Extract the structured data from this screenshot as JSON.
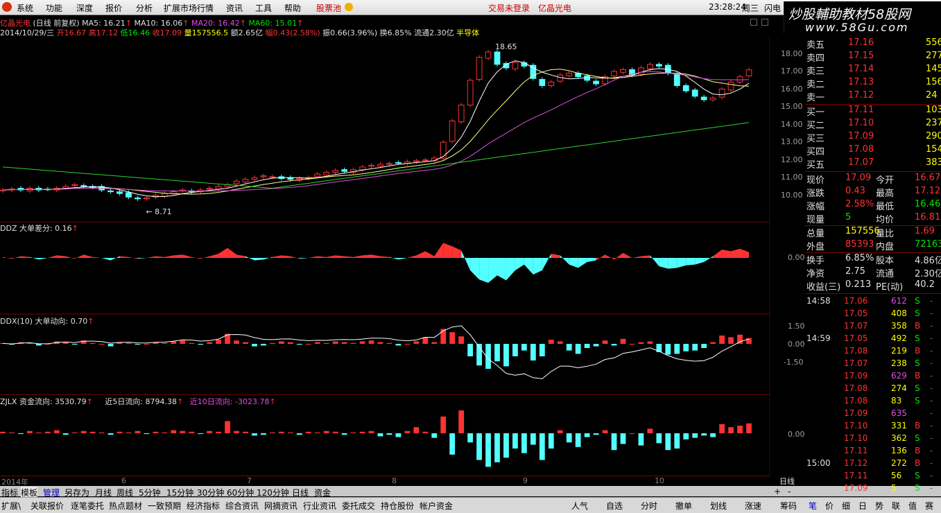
{
  "menu": {
    "items": [
      "系统",
      "功能",
      "深度",
      "报价",
      "分析",
      "扩展市场行情",
      "资讯",
      "工具",
      "帮助"
    ],
    "stock_pool": "股票池",
    "trade_status": "交易未登录",
    "stock_name": "亿晶光电",
    "clock": "23:28:24",
    "weekday": "周三",
    "flash": "闪电",
    "watermark": "炒股輔助教材58股网",
    "watermark_url": "www.58Gu.com"
  },
  "main_chart": {
    "header1_name": "亿晶光电",
    "header1_mode": "(日线 前复权)",
    "ma5": "MA5: 16.21",
    "ma10": "MA10: 16.06",
    "ma20": "MA20: 16.42",
    "ma60": "MA60: 15.01",
    "date": "2014/10/29/三",
    "open": "开16.67",
    "high": "高17.12",
    "low": "低16.46",
    "close": "收17.09",
    "volume": "量157556.5",
    "amount": "额2.65亿",
    "pct": "幅0.43(2.58%)",
    "amp": "振0.66(3.96%)",
    "turnover": "换6.85%",
    "float": "流通2.30亿",
    "sector": "半导体",
    "high_mark": "18.65",
    "low_mark": "8.71",
    "y_ticks": [
      "18.00",
      "17.00",
      "16.00",
      "15.00",
      "14.00",
      "13.00",
      "12.00",
      "11.00",
      "10.00"
    ]
  },
  "ddz": {
    "label": "DDZ 大单差分: 0.16",
    "tick": "0.00"
  },
  "ddx": {
    "label": "DDX(10) 大单动向: 0.70",
    "ticks": [
      "1.50",
      "0.00",
      "-1.50"
    ]
  },
  "zjlx": {
    "label": "ZJLX 资金流向: 3530.79",
    "d5": "近5日流向: 8794.38",
    "d10": "近10日流向: -3023.78",
    "tick": "0.00"
  },
  "time_axis": [
    "2014年",
    "6",
    "7",
    "8",
    "9",
    "10"
  ],
  "daily_label": "日线",
  "tabs_row1": [
    "指标",
    "模板",
    "管理",
    "另存为",
    "月线",
    "周线",
    "5分钟",
    "15分钟",
    "30分钟",
    "60分钟",
    "120分钟",
    "日线",
    "资金"
  ],
  "tabs_row2": [
    "扩展\\",
    "关联报价",
    "逐笔委托",
    "热点题材",
    "一致预期",
    "经济指标",
    "综合资讯",
    "网摘资讯",
    "行业资讯",
    "委托成交",
    "持仓股份",
    "帐户资金"
  ],
  "tabs_row2_right": [
    "人气",
    "自选",
    "分时",
    "撤单",
    "划线",
    "涨速"
  ],
  "tabs_row2_far": [
    "筹码",
    "笔",
    "价",
    "细",
    "日",
    "势",
    "联",
    "值",
    "赛"
  ],
  "quote": {
    "sells": [
      {
        "label": "卖五",
        "price": "17.16",
        "vol": "556"
      },
      {
        "label": "卖四",
        "price": "17.15",
        "vol": "277"
      },
      {
        "label": "卖三",
        "price": "17.14",
        "vol": "145"
      },
      {
        "label": "卖二",
        "price": "17.13",
        "vol": "156"
      },
      {
        "label": "卖一",
        "price": "17.12",
        "vol": "24"
      }
    ],
    "buys": [
      {
        "label": "买一",
        "price": "17.11",
        "vol": "103"
      },
      {
        "label": "买二",
        "price": "17.10",
        "vol": "237"
      },
      {
        "label": "买三",
        "price": "17.09",
        "vol": "290"
      },
      {
        "label": "买四",
        "price": "17.08",
        "vol": "154"
      },
      {
        "label": "买五",
        "price": "17.07",
        "vol": "383"
      }
    ],
    "stats": [
      {
        "k1": "现价",
        "v1": "17.09",
        "c1": "red",
        "k2": "今开",
        "v2": "16.67",
        "c2": "red"
      },
      {
        "k1": "涨跌",
        "v1": "0.43",
        "c1": "red",
        "k2": "最高",
        "v2": "17.12",
        "c2": "red"
      },
      {
        "k1": "涨幅",
        "v1": "2.58%",
        "c1": "red",
        "k2": "最低",
        "v2": "16.46",
        "c2": "grn"
      },
      {
        "k1": "现量",
        "v1": "5",
        "c1": "grn",
        "k2": "均价",
        "v2": "16.81",
        "c2": "red"
      },
      {
        "k1": "总量",
        "v1": "157556",
        "c1": "yel",
        "k2": "量比",
        "v2": "1.69",
        "c2": "red"
      },
      {
        "k1": "外盘",
        "v1": "85393",
        "c1": "red",
        "k2": "内盘",
        "v2": "72163",
        "c2": "grn"
      },
      {
        "k1": "换手",
        "v1": "6.85%",
        "c1": "wht",
        "k2": "股本",
        "v2": "4.86亿",
        "c2": "wht"
      },
      {
        "k1": "净资",
        "v1": "2.75",
        "c1": "wht",
        "k2": "流通",
        "v2": "2.30亿",
        "c2": "wht"
      },
      {
        "k1": "收益(三)",
        "v1": "0.213",
        "c1": "wht",
        "k2": "PE(动)",
        "v2": "40.2",
        "c2": "wht"
      }
    ],
    "ticks": [
      {
        "t": "14:58",
        "p": "17.06",
        "pc": "red",
        "v": "612",
        "vc": "mag",
        "s": "S"
      },
      {
        "t": "",
        "p": "17.05",
        "pc": "red",
        "v": "408",
        "vc": "yel",
        "s": "S"
      },
      {
        "t": "",
        "p": "17.07",
        "pc": "red",
        "v": "358",
        "vc": "yel",
        "s": "B"
      },
      {
        "t": "14:59",
        "p": "17.05",
        "pc": "red",
        "v": "492",
        "vc": "yel",
        "s": "S"
      },
      {
        "t": "",
        "p": "17.08",
        "pc": "red",
        "v": "219",
        "vc": "yel",
        "s": "B"
      },
      {
        "t": "",
        "p": "17.07",
        "pc": "red",
        "v": "238",
        "vc": "yel",
        "s": "S"
      },
      {
        "t": "",
        "p": "17.09",
        "pc": "red",
        "v": "629",
        "vc": "mag",
        "s": "B"
      },
      {
        "t": "",
        "p": "17.08",
        "pc": "red",
        "v": "274",
        "vc": "yel",
        "s": "S"
      },
      {
        "t": "",
        "p": "17.08",
        "pc": "red",
        "v": "83",
        "vc": "yel",
        "s": "S"
      },
      {
        "t": "",
        "p": "17.09",
        "pc": "red",
        "v": "635",
        "vc": "mag",
        "s": ""
      },
      {
        "t": "",
        "p": "17.10",
        "pc": "red",
        "v": "331",
        "vc": "yel",
        "s": "B"
      },
      {
        "t": "",
        "p": "17.10",
        "pc": "red",
        "v": "362",
        "vc": "yel",
        "s": "S"
      },
      {
        "t": "",
        "p": "17.11",
        "pc": "red",
        "v": "136",
        "vc": "yel",
        "s": "B"
      },
      {
        "t": "15:00",
        "p": "17.12",
        "pc": "red",
        "v": "272",
        "vc": "yel",
        "s": "B"
      },
      {
        "t": "",
        "p": "17.11",
        "pc": "red",
        "v": "56",
        "vc": "yel",
        "s": "S"
      },
      {
        "t": "",
        "p": "17.09",
        "pc": "red",
        "v": "5",
        "vc": "yel",
        "s": "S"
      }
    ]
  },
  "chart_data": {
    "type": "candlestick",
    "closes": [
      10.3,
      10.35,
      10.3,
      10.4,
      10.3,
      10.35,
      10.4,
      10.5,
      10.6,
      10.5,
      10.45,
      10.3,
      10.2,
      10.1,
      9.9,
      9.8,
      9.85,
      10.0,
      10.1,
      10.2,
      10.3,
      10.2,
      10.3,
      10.4,
      10.5,
      10.6,
      10.8,
      10.9,
      11.0,
      11.1,
      11.05,
      10.95,
      10.9,
      10.95,
      11.0,
      11.2,
      11.3,
      11.4,
      11.35,
      11.45,
      11.6,
      11.7,
      11.75,
      11.8,
      11.85,
      11.9,
      11.95,
      12.0,
      12.1,
      13.0,
      14.2,
      15.1,
      16.5,
      17.8,
      18.1,
      17.4,
      17.2,
      17.5,
      17.3,
      16.6,
      16.2,
      16.4,
      16.8,
      16.9,
      16.7,
      16.5,
      16.3,
      16.7,
      17.0,
      17.1,
      16.8,
      17.2,
      17.4,
      17.3,
      16.9,
      16.2,
      15.9,
      15.6,
      15.4,
      15.5,
      16.0,
      16.4,
      16.7,
      17.09
    ],
    "ddx": [
      0.1,
      -0.1,
      0.2,
      0.1,
      -0.2,
      0.0,
      0.3,
      0.2,
      -0.1,
      0.4,
      0.1,
      0.0,
      -0.3,
      0.2,
      0.1,
      -0.1,
      0.0,
      0.2,
      0.1,
      0.3,
      0.4,
      0.1,
      -0.1,
      0.2,
      0.5,
      1.2,
      0.4,
      0.2,
      -0.3,
      -0.2,
      0.1,
      0.3,
      0.2,
      -0.1,
      0.0,
      0.2,
      0.1,
      0.3,
      0.2,
      0.1,
      0.3,
      0.4,
      0.2,
      0.1,
      -0.2,
      0.0,
      0.3,
      0.8,
      0.2,
      1.8,
      1.4,
      0.9,
      -1.5,
      -2.6,
      -3.0,
      -2.1,
      -2.7,
      -1.5,
      -0.8,
      -2.0,
      -1.5,
      0.5,
      0.3,
      -0.8,
      -1.2,
      -0.5,
      -0.3,
      0.4,
      -0.2,
      0.6,
      0.0,
      0.2,
      0.3,
      -1.0,
      -1.3,
      -1.2,
      -0.9,
      -0.8,
      -0.5,
      0.2,
      1.0,
      0.8,
      1.1,
      0.7
    ],
    "zjlx": [
      0.2,
      0.1,
      -0.1,
      0.3,
      0.1,
      0.2,
      0.4,
      -0.2,
      0.1,
      0.3,
      0.2,
      0.1,
      -0.2,
      0.2,
      0.1,
      0.3,
      -0.1,
      0.2,
      0.1,
      0.4,
      0.3,
      0.2,
      -0.1,
      0.3,
      0.2,
      1.6,
      0.3,
      0.2,
      -0.3,
      -0.2,
      0.1,
      0.2,
      0.1,
      -0.2,
      0.2,
      0.1,
      0.3,
      0.2,
      -0.2,
      0.1,
      0.2,
      0.3,
      -0.4,
      -0.2,
      -0.5,
      0.3,
      0.8,
      0.2,
      -0.6,
      2.2,
      -2.8,
      3.0,
      -1.2,
      -3.5,
      -4.4,
      -3.8,
      -3.2,
      -2.0,
      -2.6,
      -1.5,
      -3.5,
      -2.0,
      0.4,
      -1.2,
      -1.8,
      -0.5,
      -0.2,
      0.4,
      -2.2,
      -1.4,
      0.0,
      -1.6,
      0.6,
      -1.3,
      -2.2,
      -2.0,
      -0.8,
      -0.6,
      -0.3,
      -0.5,
      1.2,
      0.8,
      1.0,
      1.3
    ]
  }
}
